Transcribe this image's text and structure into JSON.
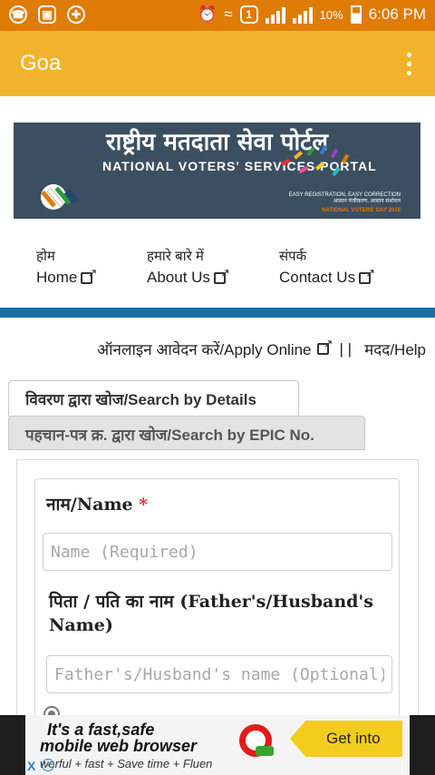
{
  "status_bar": {
    "battery": "10%",
    "time": "6:06 PM",
    "sim_slot": "1",
    "icons": [
      "whatsapp-icon",
      "gallery-icon",
      "game-icon",
      "alarm-icon",
      "wifi-icon",
      "sim-icon",
      "signal-icon",
      "battery-icon"
    ]
  },
  "app_bar": {
    "title": "Goa",
    "menu_icon": "overflow-menu-icon"
  },
  "banner": {
    "title_hindi": "राष्ट्रीय मतदाता सेवा पोर्टल",
    "title_english": "NATIONAL VOTERS' SERVICES PORTAL",
    "tagline_line1": "EASY REGISTRATION, EASY CORRECTION",
    "tagline_line2": "आसान पंजीकरण, आसान संशोधन",
    "day_text": "NATIONAL VOTERS' DAY 2015"
  },
  "nav": {
    "items": [
      {
        "hindi": "होम",
        "english": "Home"
      },
      {
        "hindi": "हमारे बारे में",
        "english": "About Us"
      },
      {
        "hindi": "संपर्क",
        "english": "Contact Us"
      }
    ]
  },
  "links": {
    "apply_online": "ऑनलाइन आवेदन करें/Apply Online",
    "separator": "| |",
    "help": "मदद/Help"
  },
  "tabs": {
    "by_details": "विवरण द्वारा खोज/Search by Details",
    "by_epic": "पहचान-पत्र क्र. द्वारा खोज/Search by EPIC No."
  },
  "form": {
    "name_label": "नाम/Name",
    "required_marker": "*",
    "name_placeholder": "Name (Required)",
    "name_value": "",
    "father_label": "पिता / पति का नाम (Father's/Husband's Name)",
    "father_placeholder": "Father's/Husband's name (Optional)",
    "father_value": ""
  },
  "ad": {
    "line1": "It's a fast,safe",
    "line2": "mobile web browser",
    "line3": "werful + fast + Save time + Fluen",
    "cta": "Get into",
    "close": "X",
    "info": "i"
  },
  "colors": {
    "status_bar": "#e07b06",
    "app_bar": "#f2b32c",
    "nav_divider": "#1d6fa0",
    "required": "#d9302c",
    "banner_bg": "#3c4f61"
  }
}
